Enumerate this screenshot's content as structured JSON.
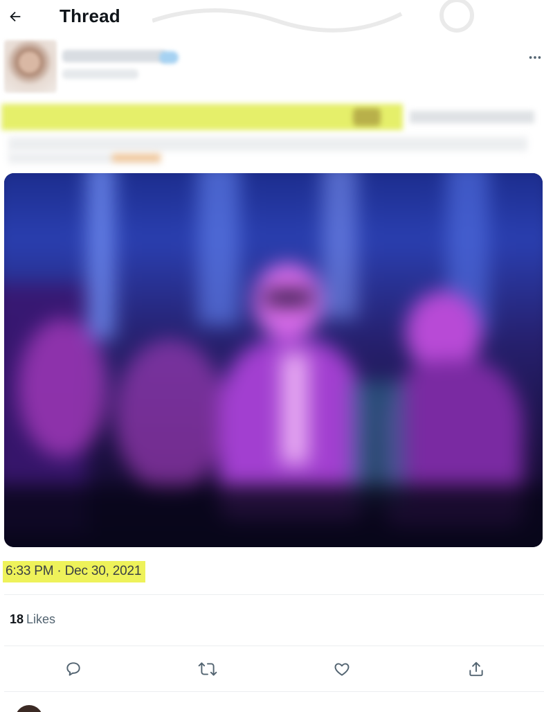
{
  "header": {
    "title": "Thread",
    "back_icon": "arrow-left-icon"
  },
  "tweet": {
    "more_icon": "more-horizontal-icon",
    "timestamp": "6:33 PM · Dec 30, 2021",
    "likes": {
      "count": "18",
      "label": "Likes"
    },
    "actions": [
      {
        "icon": "reply-icon"
      },
      {
        "icon": "retweet-icon"
      },
      {
        "icon": "like-icon"
      },
      {
        "icon": "share-icon"
      }
    ]
  },
  "colors": {
    "highlight": "#eef25a",
    "text_primary": "#0f1419",
    "text_secondary": "#536471",
    "icon": "#536471"
  }
}
